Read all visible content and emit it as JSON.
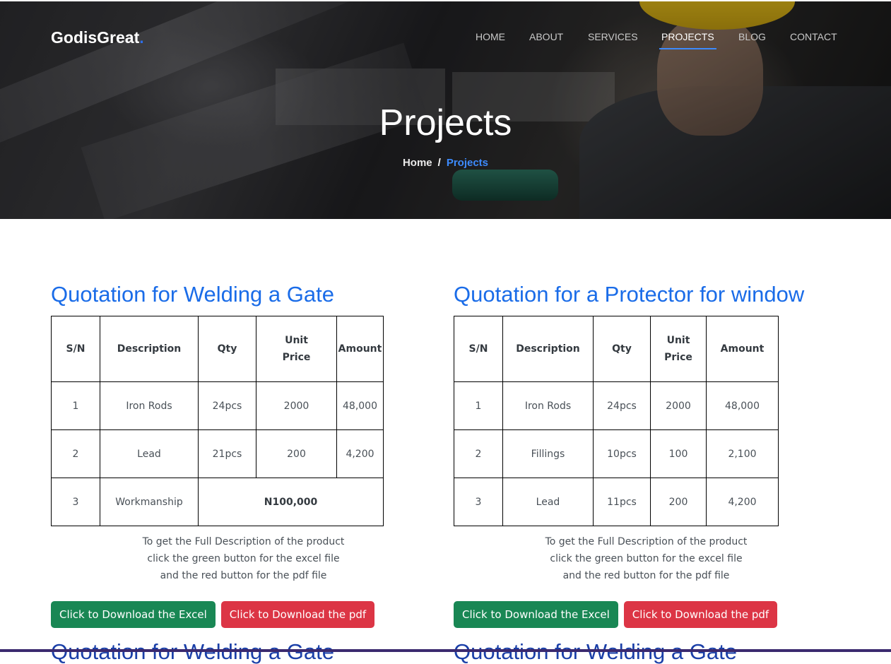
{
  "brand": {
    "name": "GodisGreat",
    "dot": "."
  },
  "nav": [
    {
      "label": "HOME",
      "active": false
    },
    {
      "label": "ABOUT",
      "active": false
    },
    {
      "label": "SERVICES",
      "active": false
    },
    {
      "label": "PROJECTS",
      "active": true
    },
    {
      "label": "BLOG",
      "active": false
    },
    {
      "label": "CONTACT",
      "active": false
    }
  ],
  "hero": {
    "title": "Projects",
    "breadcrumb": {
      "home": "Home",
      "separator": "/",
      "current": "Projects"
    }
  },
  "quotes": [
    {
      "title": "Quotation for Welding a Gate",
      "headers": [
        "S/N",
        "Description",
        "Qty",
        "Unit Price",
        "Amount"
      ],
      "rows": [
        {
          "sn": "1",
          "description": "Iron Rods",
          "qty": "24pcs",
          "unit_price": "2000",
          "amount": "48,000"
        },
        {
          "sn": "2",
          "description": "Lead",
          "qty": "21pcs",
          "unit_price": "200",
          "amount": "4,200"
        }
      ],
      "total_row": {
        "sn": "3",
        "description": "Workmanship",
        "amount": "N100,000"
      },
      "note": [
        "To get the Full Description of the product",
        "click the green button for the excel file",
        "and the red button for the pdf file"
      ],
      "excel_button": "Click to Download the Excel",
      "pdf_button": "Click to Download the pdf"
    },
    {
      "title": "Quotation for a Protector for window",
      "headers": [
        "S/N",
        "Description",
        "Qty",
        "Unit Price",
        "Amount"
      ],
      "rows": [
        {
          "sn": "1",
          "description": "Iron Rods",
          "qty": "24pcs",
          "unit_price": "2000",
          "amount": "48,000"
        },
        {
          "sn": "2",
          "description": "Fillings",
          "qty": "10pcs",
          "unit_price": "100",
          "amount": "2,100"
        },
        {
          "sn": "3",
          "description": "Lead",
          "qty": "11pcs",
          "unit_price": "200",
          "amount": "4,200"
        }
      ],
      "note": [
        "To get the Full Description of the product",
        "click the green button for the excel file",
        "and the red button for the pdf file"
      ],
      "excel_button": "Click to Download the Excel",
      "pdf_button": "Click to Download the pdf"
    }
  ],
  "peek_titles": [
    "Quotation for Welding a Gate",
    "Quotation for Welding a Gate"
  ],
  "colors": {
    "accent": "#1a6ce8",
    "green": "#198754",
    "red": "#dc3545",
    "nav_active_underline": "#3d8bfd"
  }
}
